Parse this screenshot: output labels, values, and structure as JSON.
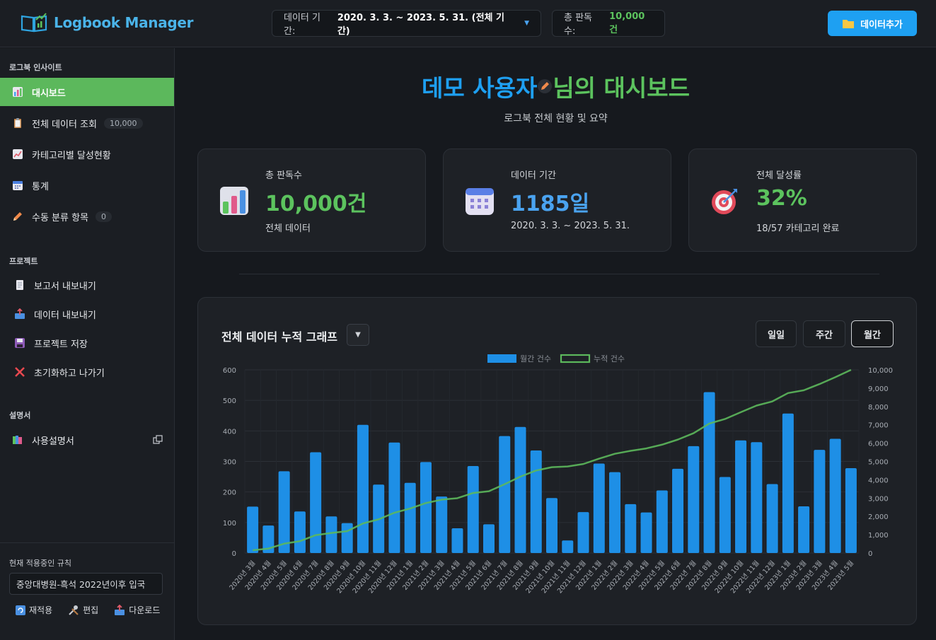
{
  "app": {
    "name": "Logbook Manager"
  },
  "topbar": {
    "period_label": "데이터 기간:",
    "period_value": "2020. 3. 3. ~ 2023. 5. 31. (전체 기간)",
    "total_label": "총 판독수:",
    "total_value": "10,000건",
    "add_button": "데이터추가"
  },
  "sidebar": {
    "section1": "로그북 인사이트",
    "items": [
      {
        "label": "대시보드"
      },
      {
        "label": "전체 데이터 조회",
        "badge": "10,000"
      },
      {
        "label": "카테고리별 달성현황"
      },
      {
        "label": "통계"
      },
      {
        "label": "수동 분류 항목",
        "badge": "0"
      }
    ],
    "section2": "프로젝트",
    "project_items": [
      {
        "label": "보고서 내보내기"
      },
      {
        "label": "데이터 내보내기"
      },
      {
        "label": "프로젝트 저장"
      },
      {
        "label": "초기화하고 나가기"
      }
    ],
    "section3": "설명서",
    "manual_item": {
      "label": "사용설명서"
    },
    "rule_label": "현재 적용중인 규칙",
    "rule_value": "중앙대병원-흑석 2022년이후 입국",
    "rule_actions": {
      "reapply": "재적용",
      "edit": "편집",
      "download": "다운로드"
    }
  },
  "main": {
    "title_a": "데모 사용자",
    "title_b": "님의 대시보드",
    "subtitle": "로그북 전체 현황 및 요약",
    "cards": [
      {
        "label": "총 판독수",
        "value": "10,000건",
        "sub": "전체 데이터",
        "color": "#5cc35e"
      },
      {
        "label": "데이터 기간",
        "value": "1185일",
        "sub": "2020. 3. 3. ~ 2023. 5. 31.",
        "color": "#4aa3f0"
      },
      {
        "label": "전체 달성률",
        "value": "32%",
        "sub": "18/57 카테고리 완료",
        "color": "#5cc35e"
      }
    ],
    "chart_title": "전체 데이터 누적 그래프",
    "toggles": [
      "일일",
      "주간",
      "월간"
    ],
    "active_toggle": "월간"
  },
  "chart_data": {
    "type": "bar",
    "categories": [
      "2020년 3월",
      "2020년 4월",
      "2020년 5월",
      "2020년 6월",
      "2020년 7월",
      "2020년 8월",
      "2020년 9월",
      "2020년 10월",
      "2020년 11월",
      "2020년 12월",
      "2021년 1월",
      "2021년 2월",
      "2021년 3월",
      "2021년 4월",
      "2021년 5월",
      "2021년 6월",
      "2021년 7월",
      "2021년 8월",
      "2021년 9월",
      "2021년 10월",
      "2021년 11월",
      "2021년 12월",
      "2022년 1월",
      "2022년 2월",
      "2022년 3월",
      "2022년 4월",
      "2022년 5월",
      "2022년 6월",
      "2022년 7월",
      "2022년 8월",
      "2022년 9월",
      "2022년 10월",
      "2022년 11월",
      "2022년 12월",
      "2023년 1월",
      "2023년 2월",
      "2023년 3월",
      "2023년 4월",
      "2023년 5월"
    ],
    "series": [
      {
        "name": "월간 건수",
        "type": "bar",
        "axis": "left",
        "color": "#1e8fe6",
        "values": [
          152,
          90,
          268,
          136,
          330,
          120,
          98,
          420,
          224,
          362,
          230,
          298,
          185,
          81,
          285,
          94,
          383,
          413,
          336,
          180,
          41,
          134,
          293,
          265,
          160,
          133,
          205,
          276,
          350,
          527,
          249,
          369,
          363,
          226,
          457,
          153,
          338,
          374,
          278
        ]
      },
      {
        "name": "누적 건수",
        "type": "line",
        "axis": "right",
        "color": "#5cb85c",
        "values": [
          152,
          242,
          510,
          646,
          976,
          1096,
          1194,
          1614,
          1838,
          2200,
          2430,
          2728,
          2913,
          2994,
          3279,
          3373,
          3756,
          4169,
          4505,
          4685,
          4726,
          4860,
          5153,
          5418,
          5578,
          5711,
          5916,
          6192,
          6542,
          7069,
          7318,
          7687,
          8050,
          8276,
          8733,
          8886,
          9224,
          9598,
          10000
        ]
      }
    ],
    "legend": [
      "월간 건수",
      "누적 건수"
    ],
    "legend_position": "top",
    "y_left": {
      "min": 0,
      "max": 600,
      "ticks": [
        "0",
        "100",
        "200",
        "300",
        "400",
        "500",
        "600"
      ]
    },
    "y_right": {
      "min": 0,
      "max": 10000,
      "ticks": [
        "0",
        "1,000",
        "2,000",
        "3,000",
        "4,000",
        "5,000",
        "6,000",
        "7,000",
        "8,000",
        "9,000",
        "10,000"
      ]
    },
    "grid": true
  }
}
